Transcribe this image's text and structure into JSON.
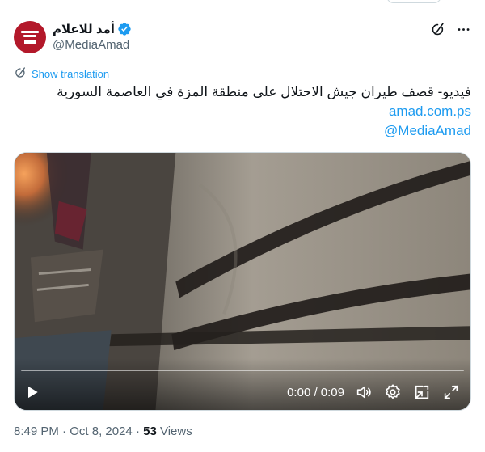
{
  "tweet": {
    "display_name": "أمد للاعلام",
    "handle": "@MediaAmad",
    "translate_label": "Show translation",
    "text_line": "فيديو- قصف طيران جيش الاحتلال على منطقة المزة في العاصمة السورية",
    "link_1": "amad.com.ps",
    "link_2": "@MediaAmad"
  },
  "video": {
    "time_display": "0:00 / 0:09",
    "progress": 0
  },
  "meta": {
    "time": "8:49 PM",
    "date": "Oct 8, 2024",
    "separator": "·",
    "views_count": "53",
    "views_label": "Views"
  },
  "colors": {
    "accent": "#1d9bf0",
    "muted": "#536471",
    "avatar_bg": "#b3182a"
  },
  "icons": {
    "verified": "verified-badge-icon",
    "grok": "grok-icon",
    "more": "more-icon",
    "translate": "translate-icon",
    "play": "play-icon",
    "volume": "volume-icon",
    "settings": "settings-icon",
    "popout": "popout-icon",
    "fullscreen": "fullscreen-icon"
  }
}
